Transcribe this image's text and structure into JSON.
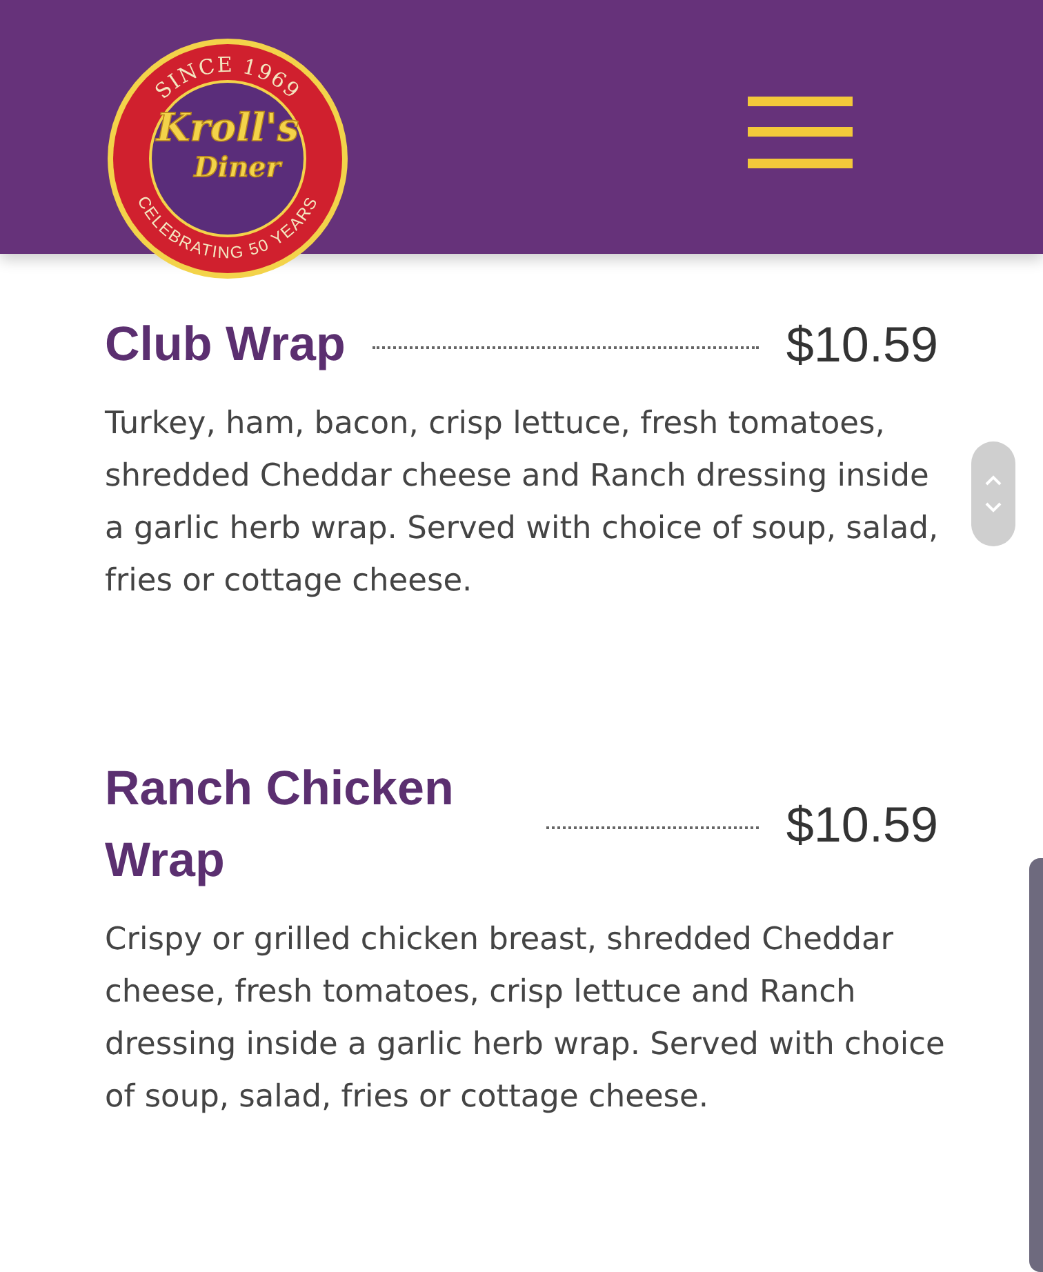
{
  "header": {
    "logo": {
      "top_text": "SINCE 1969",
      "name": "Kroll's",
      "subname": "Diner",
      "bottom_text": "CELEBRATING 50 YEARS"
    }
  },
  "menu_items": [
    {
      "name": "Club Wrap",
      "price": "$10.59",
      "description": "Turkey, ham, bacon, crisp lettuce, fresh tomatoes, shredded Cheddar cheese and Ranch dressing inside a garlic herb wrap. Served with choice of soup, salad, fries or cottage cheese."
    },
    {
      "name": "Ranch Chicken Wrap",
      "price": "$10.59",
      "description": "Crispy or grilled chicken breast, shredded Cheddar cheese, fresh tomatoes, crisp lettuce and Ranch dressing inside a garlic herb wrap. Served with choice of soup, salad, fries or cottage cheese."
    }
  ]
}
